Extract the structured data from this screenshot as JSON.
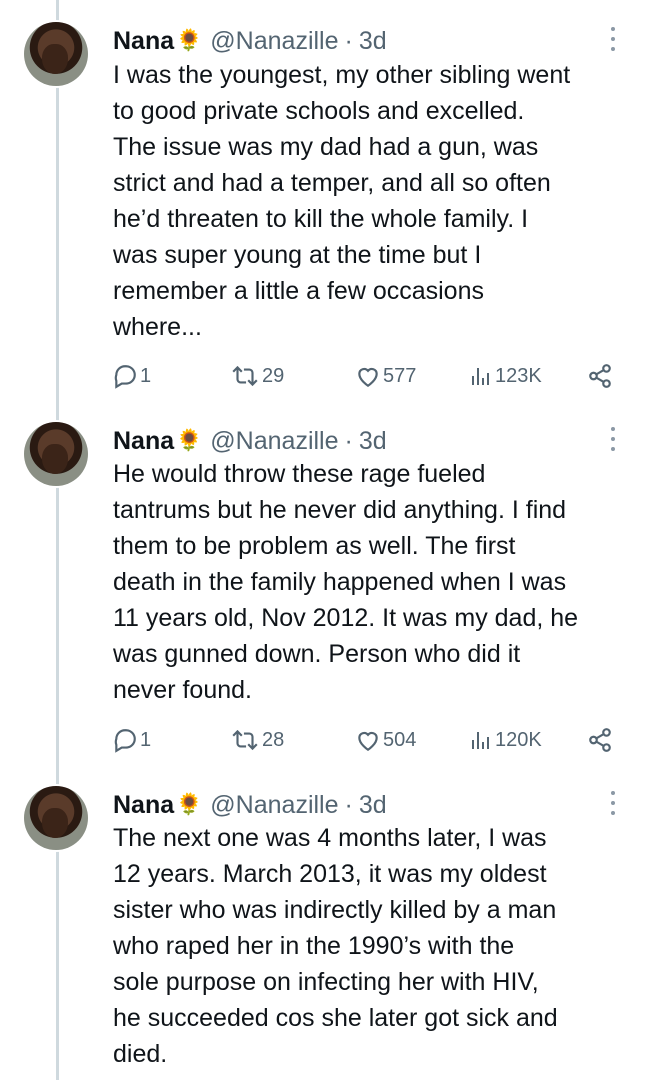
{
  "tweets": [
    {
      "author_name": "Nana",
      "handle": "@Nanazille",
      "separator": "·",
      "age": "3d",
      "text": "I was the youngest, my other sibling went\nto good private schools and excelled.\nThe issue was my dad had a gun, was\nstrict and had a temper, and all so often\nhe’d threaten to kill the whole family. I\nwas super young at the time but I\nremember a little a few occasions\nwhere...",
      "replies": "1",
      "reposts": "29",
      "likes": "577",
      "views": "123K"
    },
    {
      "author_name": "Nana",
      "handle": "@Nanazille",
      "separator": "·",
      "age": "3d",
      "text": "He would throw these rage fueled\ntantrums but he never did anything. I find\nthem to be problem as well.  The first\ndeath in the family happened when I was\n11 years old, Nov 2012. It was my dad, he\nwas gunned down. Person who did it\nnever found.",
      "replies": "1",
      "reposts": "28",
      "likes": "504",
      "views": "120K"
    },
    {
      "author_name": "Nana",
      "handle": "@Nanazille",
      "separator": "·",
      "age": "3d",
      "text": "The next one was 4 months later, I was\n12 years. March 2013, it was my oldest\nsister who was indirectly killed by a man\nwho  raped her in the 1990’s with the\nsole purpose on infecting her with HIV,\nhe succeeded cos she later got sick and\ndied."
    }
  ]
}
